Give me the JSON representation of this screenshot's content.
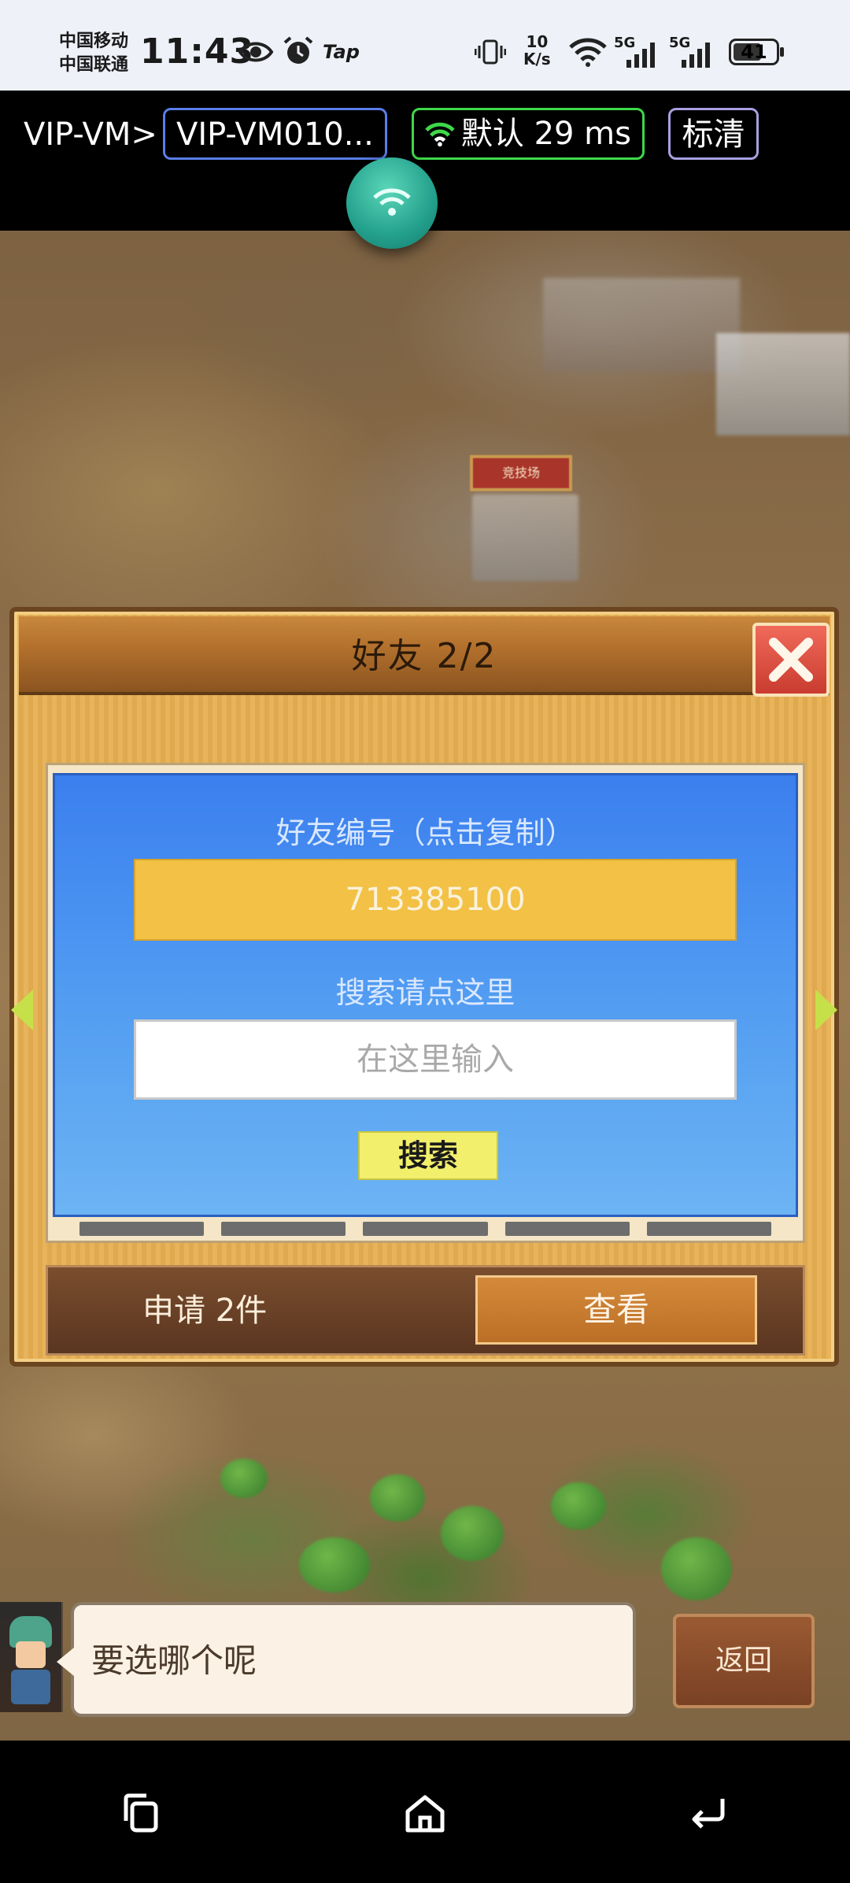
{
  "status_bar": {
    "carrier_1": "中国移动",
    "carrier_2": "中国联通",
    "time": "11:43",
    "tap_label": "Tap",
    "net_speed_value": "10",
    "net_speed_unit": "K/s",
    "signal_1_label": "5G",
    "signal_2_label": "5G",
    "battery": "41",
    "icons": [
      "eye-icon",
      "alarm-icon",
      "vibrate-icon",
      "wifi-icon",
      "signal-icon",
      "signal-icon",
      "battery-icon"
    ]
  },
  "vm_toolbar": {
    "breadcrumb_root": "VIP-VM",
    "separator": ">",
    "vm_name": "VIP-VM010...",
    "network_label": "默认 29 ms",
    "quality_label": "标清",
    "colors": {
      "vm_border": "#5a7ee8",
      "network_border": "#3ed84a",
      "quality_border": "#a8a0e0",
      "fab": "#23a08c"
    }
  },
  "game": {
    "building_sign": "竞技场",
    "friend_dialog": {
      "title": "好友    2/2",
      "id_label": "好友编号（点击复制）",
      "friend_id": "713385100",
      "search_label": "搜索请点这里",
      "search_placeholder": "在这里输入",
      "search_button": "搜索",
      "request_text": "申请 2件",
      "view_button": "查看"
    },
    "chat_text": "要选哪个呢",
    "back_button": "返回"
  },
  "nav_bar": {
    "icons": [
      "recent-apps-icon",
      "home-icon",
      "back-icon"
    ]
  }
}
